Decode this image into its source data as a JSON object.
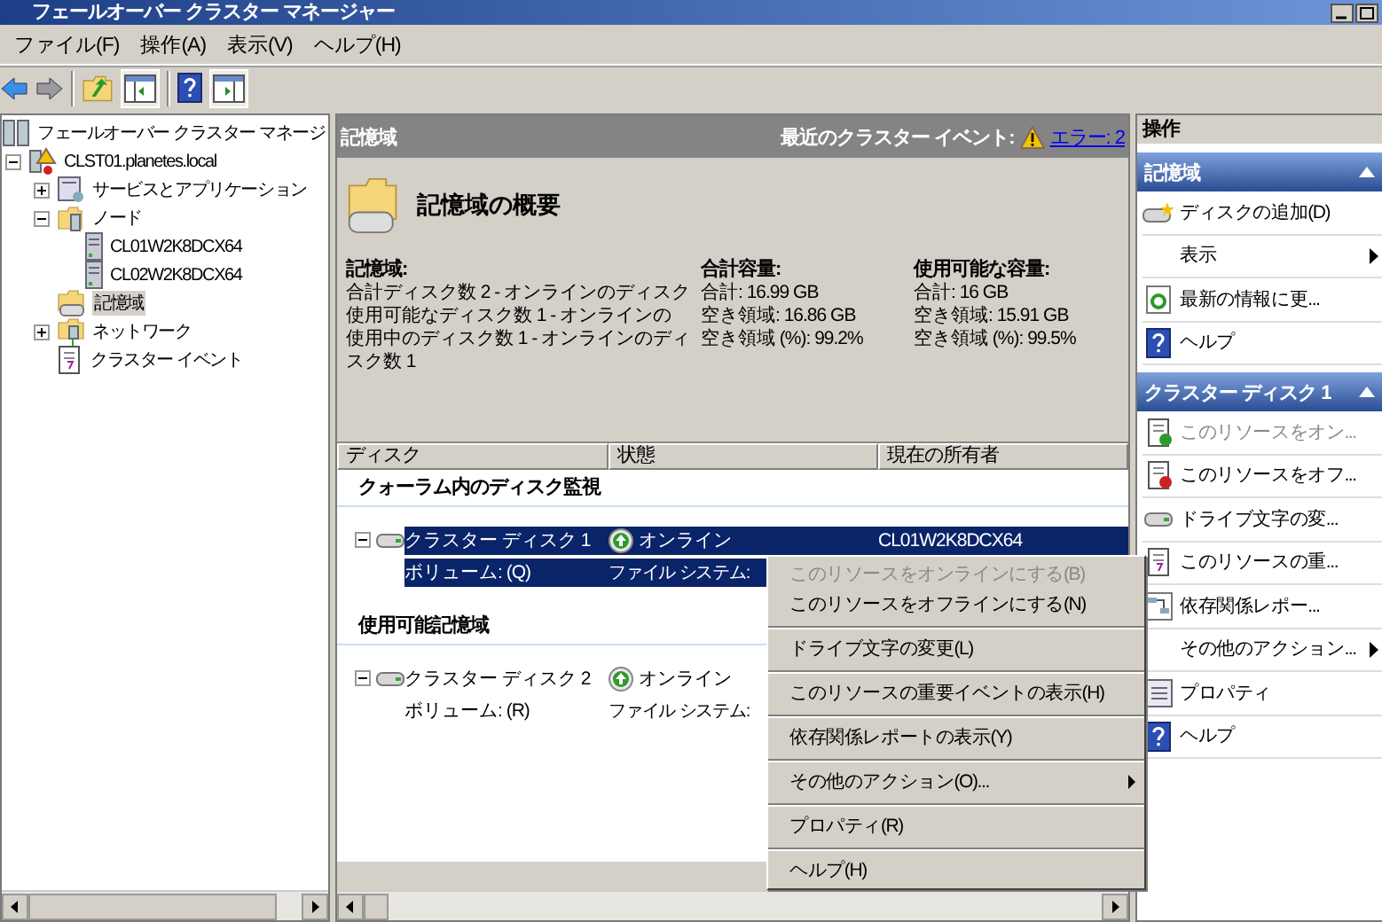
{
  "window": {
    "title": "フェールオーバー クラスター マネージャー"
  },
  "menu": [
    "ファイル(F)",
    "操作(A)",
    "表示(V)",
    "ヘルプ(H)"
  ],
  "toolbar": [
    {
      "kind": "back"
    },
    {
      "kind": "forward"
    },
    {
      "kind": "sep"
    },
    {
      "kind": "up"
    },
    {
      "kind": "tree-pane",
      "on": true
    },
    {
      "kind": "sep"
    },
    {
      "kind": "help"
    },
    {
      "kind": "action-pane",
      "on": true
    }
  ],
  "tree": [
    {
      "label": "フェールオーバー クラスター マネージ",
      "kind": "manager",
      "selected": false,
      "children": [
        {
          "label": "CLST01.planetes.local",
          "kind": "cluster",
          "expanded": true,
          "selected": false,
          "children": [
            {
              "label": "サービスとアプリケーション",
              "kind": "services",
              "expanded": false,
              "selected": false
            },
            {
              "label": "ノード",
              "kind": "nodes",
              "expanded": true,
              "selected": false,
              "children": [
                {
                  "label": "CL01W2K8DCX64",
                  "kind": "server",
                  "selected": false
                },
                {
                  "label": "CL02W2K8DCX64",
                  "kind": "server",
                  "selected": false
                }
              ]
            },
            {
              "label": "記憶域",
              "kind": "storage",
              "selected": true
            },
            {
              "label": "ネットワーク",
              "kind": "network",
              "expanded": false,
              "selected": false
            },
            {
              "label": "クラスター イベント",
              "kind": "events",
              "selected": false
            }
          ]
        }
      ]
    }
  ],
  "center": {
    "title": "記憶域",
    "events_label": "最近のクラスター イベント:",
    "events_link": "エラー: 2",
    "summary": {
      "title": "記憶域の概要",
      "columns": [
        {
          "heading": "記憶域:",
          "lines": [
            "合計ディスク数 2 - オンラインのディスク",
            "使用可能なディスク数 1 - オンラインの",
            "使用中のディスク数 1 - オンラインのディスク数 1"
          ]
        },
        {
          "heading": "合計容量:",
          "lines": [
            "合計: 16.99 GB",
            "空き領域: 16.86 GB",
            "空き領域 (%): 99.2%"
          ]
        },
        {
          "heading": "使用可能な容量:",
          "lines": [
            "合計: 16 GB",
            "空き領域: 15.91 GB",
            "空き領域 (%): 99.5%"
          ]
        }
      ]
    },
    "table": {
      "columns": [
        "ディスク",
        "状態",
        "現在の所有者"
      ],
      "groups": [
        {
          "title": "クォーラム内のディスク監視",
          "rows": [
            {
              "name": "クラスター ディスク 1",
              "volume": "ボリューム: (Q)",
              "status": "オンライン",
              "filesystem": "ファイル システム:",
              "owner": "CL01W2K8DCX64",
              "expanded": true,
              "selected": true
            }
          ]
        },
        {
          "title": "使用可能記憶域",
          "rows": [
            {
              "name": "クラスター ディスク 2",
              "volume": "ボリューム: (R)",
              "status": "オンライン",
              "filesystem": "ファイル システム:",
              "expanded": true,
              "selected": false
            }
          ]
        }
      ]
    }
  },
  "context_menu": [
    {
      "label": "このリソースをオンラインにする(B)",
      "disabled": true,
      "submenu": false,
      "separator_after": false
    },
    {
      "label": "このリソースをオフラインにする(N)",
      "disabled": false,
      "submenu": false,
      "separator_after": true
    },
    {
      "label": "ドライブ文字の変更(L)",
      "disabled": false,
      "submenu": false,
      "separator_after": true
    },
    {
      "label": "このリソースの重要イベントの表示(H)",
      "disabled": false,
      "submenu": false,
      "separator_after": true
    },
    {
      "label": "依存関係レポートの表示(Y)",
      "disabled": false,
      "submenu": false,
      "separator_after": true
    },
    {
      "label": "その他のアクション(O)...",
      "disabled": false,
      "submenu": true,
      "separator_after": true
    },
    {
      "label": "プロパティ(R)",
      "disabled": false,
      "submenu": false,
      "separator_after": true
    },
    {
      "label": "ヘルプ(H)",
      "disabled": false,
      "submenu": false,
      "separator_after": false
    }
  ],
  "actions": {
    "title": "操作",
    "sections": [
      {
        "title": "記憶域",
        "expanded": true,
        "items": [
          {
            "label": "ディスクの追加(D)",
            "kind": "add-disk",
            "disabled": false,
            "submenu": false
          },
          {
            "label": "表示",
            "kind": "none",
            "disabled": false,
            "submenu": true
          },
          {
            "label": "最新の情報に更...",
            "kind": "refresh",
            "disabled": false,
            "submenu": false
          },
          {
            "label": "ヘルプ",
            "kind": "help",
            "disabled": false,
            "submenu": false
          }
        ]
      },
      {
        "title": "クラスター ディスク 1",
        "expanded": true,
        "items": [
          {
            "label": "このリソースをオン...",
            "kind": "online",
            "disabled": true,
            "submenu": false
          },
          {
            "label": "このリソースをオフ...",
            "kind": "offline",
            "disabled": false,
            "submenu": false
          },
          {
            "label": "ドライブ文字の変...",
            "kind": "drive",
            "disabled": false,
            "submenu": false
          },
          {
            "label": "このリソースの重...",
            "kind": "events",
            "disabled": false,
            "submenu": false
          },
          {
            "label": "依存関係レポー...",
            "kind": "report",
            "disabled": false,
            "submenu": false
          },
          {
            "label": "その他のアクション...",
            "kind": "none",
            "disabled": false,
            "submenu": true
          },
          {
            "label": "プロパティ",
            "kind": "props",
            "disabled": false,
            "submenu": false
          },
          {
            "label": "ヘルプ",
            "kind": "help",
            "disabled": false,
            "submenu": false
          }
        ]
      }
    ]
  }
}
